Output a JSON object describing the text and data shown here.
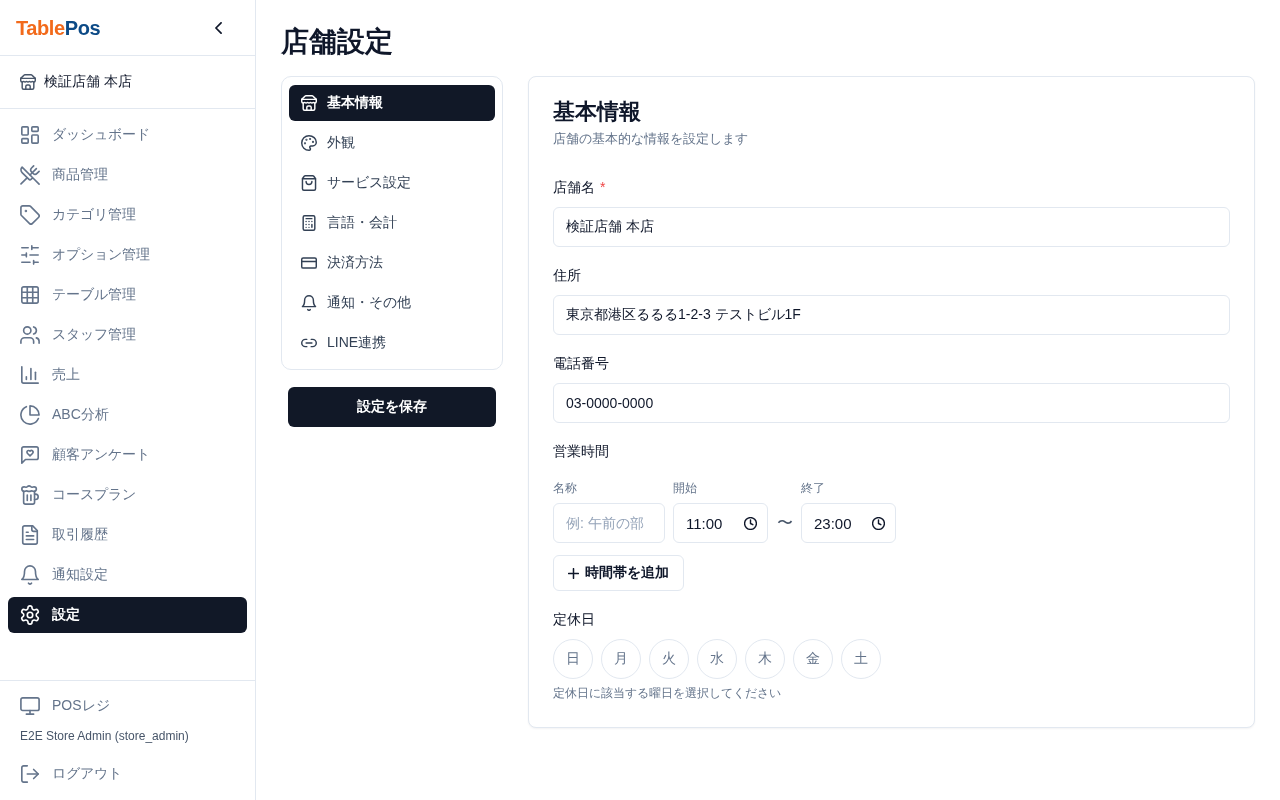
{
  "sidebar": {
    "logo": [
      "Table",
      "Pos"
    ],
    "store_name": "検証店舗 本店",
    "nav": [
      {
        "label": "ダッシュボード",
        "selected": false
      },
      {
        "label": "商品管理",
        "selected": false
      },
      {
        "label": "カテゴリ管理",
        "selected": false
      },
      {
        "label": "オプション管理",
        "selected": false
      },
      {
        "label": "テーブル管理",
        "selected": false
      },
      {
        "label": "スタッフ管理",
        "selected": false
      },
      {
        "label": "売上",
        "selected": false
      },
      {
        "label": "ABC分析",
        "selected": false
      },
      {
        "label": "顧客アンケート",
        "selected": false
      },
      {
        "label": "コースプラン",
        "selected": false
      },
      {
        "label": "取引履歴",
        "selected": false
      },
      {
        "label": "通知設定",
        "selected": false
      },
      {
        "label": "設定",
        "selected": true
      }
    ],
    "footer": {
      "pos_link": "POSレジ",
      "user": "E2E Store Admin (store_admin)",
      "logout": "ログアウト"
    }
  },
  "page_title": "店舗設定",
  "settings_nav": {
    "items": [
      {
        "label": "基本情報",
        "selected": true
      },
      {
        "label": "外観",
        "selected": false
      },
      {
        "label": "サービス設定",
        "selected": false
      },
      {
        "label": "言語・会計",
        "selected": false
      },
      {
        "label": "決済方法",
        "selected": false
      },
      {
        "label": "通知・その他",
        "selected": false
      },
      {
        "label": "LINE連携",
        "selected": false
      }
    ],
    "save_button": "設定を保存"
  },
  "form": {
    "title": "基本情報",
    "subtitle": "店舗の基本的な情報を設定します",
    "fields": [
      {
        "label": "店舗名",
        "required_mark": "*",
        "value": "検証店舗 本店"
      },
      {
        "label": "住所",
        "value": "東京都港区るるる1-2-3 テストビル1F"
      },
      {
        "label": "電話番号",
        "value": "03-0000-0000"
      }
    ],
    "business_hours": {
      "label": "営業時間",
      "column_labels": {
        "name": "名称",
        "start": "開始",
        "end": "終了"
      },
      "slots": [
        {
          "name_placeholder": "例: 午前の部",
          "start": "11:00",
          "separator": "〜",
          "end": "23:00"
        }
      ],
      "add_button": "時間帯を追加"
    },
    "closed_days": {
      "label": "定休日",
      "days": [
        {
          "label": "日",
          "selected": false
        },
        {
          "label": "月",
          "selected": false
        },
        {
          "label": "火",
          "selected": false
        },
        {
          "label": "水",
          "selected": false
        },
        {
          "label": "木",
          "selected": false
        },
        {
          "label": "金",
          "selected": false
        },
        {
          "label": "土",
          "selected": false
        }
      ],
      "hint": "定休日に該当する曜日を選択してください"
    }
  }
}
